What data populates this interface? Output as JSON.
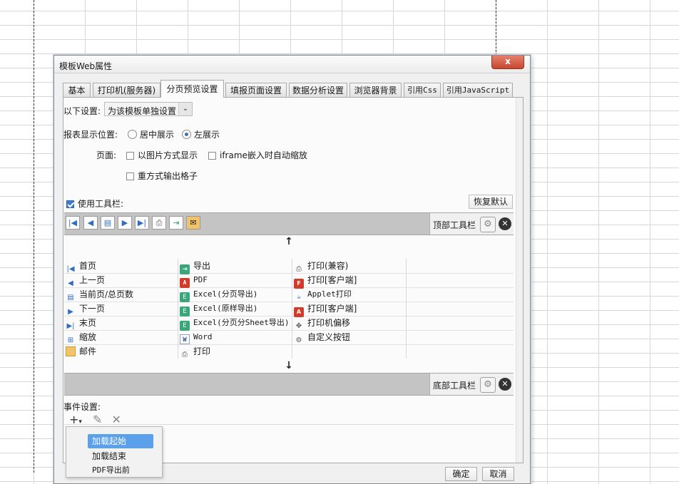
{
  "dialog": {
    "title": "模板Web属性",
    "close_label": "x"
  },
  "tabs": [
    {
      "label": "基本"
    },
    {
      "label": "打印机(服务器)"
    },
    {
      "label": "分页预览设置"
    },
    {
      "label": "填报页面设置"
    },
    {
      "label": "数据分析设置"
    },
    {
      "label": "浏览器背景"
    },
    {
      "label": "引用Css"
    },
    {
      "label": "引用JavaScript"
    }
  ],
  "settings": {
    "scope_label": "以下设置:",
    "scope_value": "为该模板单独设置",
    "position_label": "报表显示位置:",
    "position_options": [
      "居中展示",
      "左展示"
    ],
    "page_label": "页面:",
    "page_options": [
      "以图片方式显示",
      "iframe嵌入时自动缩放",
      "重方式输出格子"
    ]
  },
  "toolbar": {
    "use_toolbar_label": "使用工具栏:",
    "restore_default_label": "恢复默认",
    "top_toolbar_label": "顶部工具栏",
    "bottom_toolbar_label": "底部工具栏",
    "up_arrow": "↑",
    "down_arrow": "↓"
  },
  "buttons_table": {
    "col1": [
      "首页",
      "上一页",
      "当前页/总页数",
      "下一页",
      "末页",
      "缩放",
      "邮件"
    ],
    "col2": [
      "导出",
      "PDF",
      "Excel(分页导出)",
      "Excel(原样导出)",
      "Excel(分页分Sheet导出)",
      "Word",
      "打印"
    ],
    "col3": [
      "打印(兼容)",
      "打印[客户端]",
      "Applet打印",
      "打印[客户端]",
      "打印机偏移",
      "自定义按钮"
    ]
  },
  "events": {
    "label": "事件设置:",
    "menu_items": [
      "加载起始",
      "加载结束",
      "PDF导出前"
    ]
  },
  "footer": {
    "ok_label": "确定",
    "cancel_label": "取消"
  }
}
